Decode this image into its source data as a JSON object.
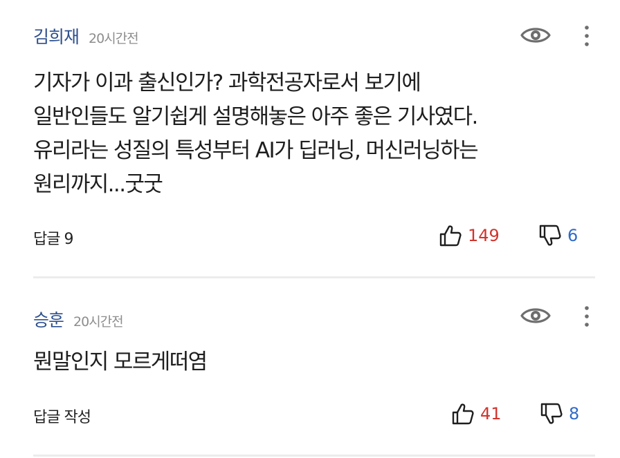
{
  "comments": [
    {
      "author": "김희재",
      "time": "20시간전",
      "lines": [
        "기자가 이과 출신인가? 과학전공자로서 보기에",
        "일반인들도 알기쉽게 설명해놓은 아주 좋은 기사였다.",
        "유리라는 성질의 특성부터 AI가 딥러닝, 머신러닝하는",
        "원리까지...굿굿"
      ],
      "reply_label": "답글 9",
      "likes": "149",
      "dislikes": "6"
    },
    {
      "author": "승훈",
      "time": "20시간전",
      "lines": [
        "뭔말인지 모르게떠염"
      ],
      "reply_label": "답글 작성",
      "likes": "41",
      "dislikes": "8"
    }
  ],
  "colors": {
    "author": "#2d4f8e",
    "likes": "#d0342c",
    "dislikes": "#2f6bc7"
  },
  "icons": {
    "view": "eye-icon",
    "more": "more-vertical-icon",
    "like": "thumbs-up-icon",
    "dislike": "thumbs-down-icon"
  }
}
